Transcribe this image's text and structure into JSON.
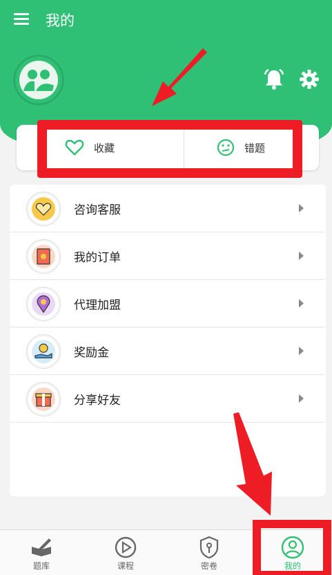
{
  "appbar": {
    "title": "我的"
  },
  "quick_actions": {
    "favorites_label": "收藏",
    "mistakes_label": "错题"
  },
  "menu": {
    "items": [
      {
        "label": "咨询客服",
        "icon": "heart-service-icon"
      },
      {
        "label": "我的订单",
        "icon": "order-envelope-icon"
      },
      {
        "label": "代理加盟",
        "icon": "location-pin-icon"
      },
      {
        "label": "奖励金",
        "icon": "coin-hand-icon"
      },
      {
        "label": "分享好友",
        "icon": "gift-box-icon"
      }
    ]
  },
  "tabbar": {
    "tabs": [
      {
        "label": "题库",
        "icon": "book-pen-icon"
      },
      {
        "label": "课程",
        "icon": "play-circle-icon"
      },
      {
        "label": "密卷",
        "icon": "shield-key-icon"
      },
      {
        "label": "我的",
        "icon": "user-circle-icon",
        "active": true
      }
    ]
  },
  "colors": {
    "primary": "#2fc076",
    "annotation_red": "#ee1c24"
  }
}
